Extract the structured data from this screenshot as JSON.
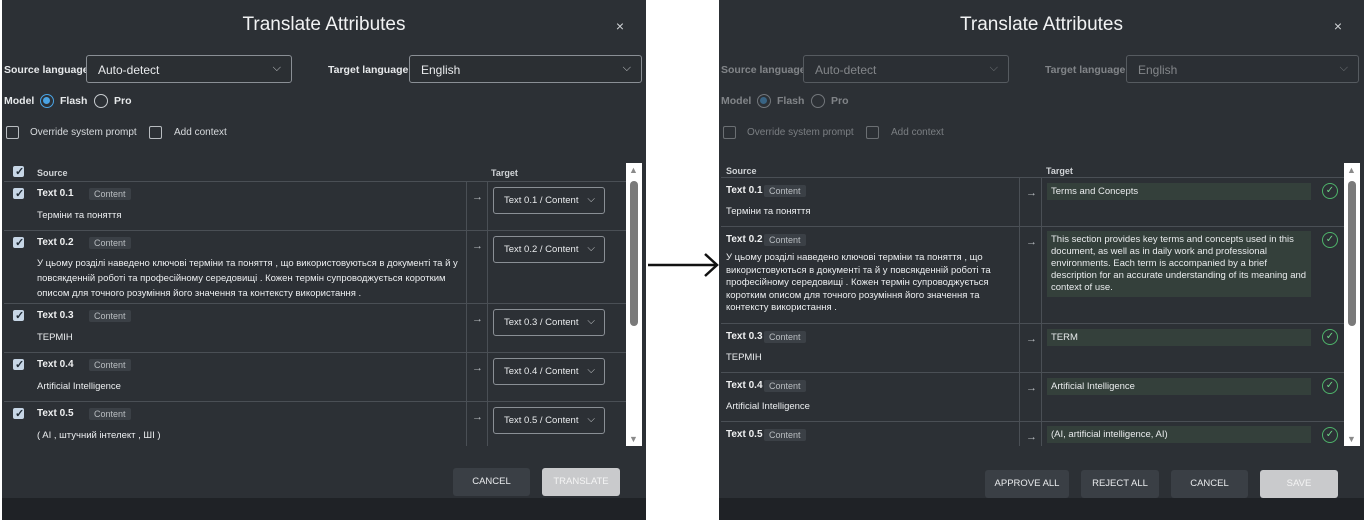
{
  "left": {
    "title": "Translate Attributes",
    "close": "×",
    "source_language_label": "Source language",
    "source_language_value": "Auto-detect",
    "target_language_label": "Target language",
    "target_language_value": "English",
    "model_label": "Model",
    "model_options": [
      "Flash",
      "Pro"
    ],
    "override_label": "Override system prompt",
    "add_context_label": "Add context",
    "col_source": "Source",
    "col_target": "Target",
    "rows": [
      {
        "title": "Text 0.1",
        "badge": "Content",
        "text": "Терміни та поняття",
        "target": "Text 0.1 / Content"
      },
      {
        "title": "Text 0.2",
        "badge": "Content",
        "text": "У цьому розділі наведено ключові терміни та поняття , що використовуються в документі та й у повсякденній роботі та професійному середовищі . Кожен термін супроводжується коротким описом для точного розуміння його значення та контексту використання .",
        "target": "Text 0.2 / Content"
      },
      {
        "title": "Text 0.3",
        "badge": "Content",
        "text": "ТЕРМІН",
        "target": "Text 0.3 / Content"
      },
      {
        "title": "Text 0.4",
        "badge": "Content",
        "text": "Artificial Intelligence",
        "target": "Text 0.4 / Content"
      },
      {
        "title": "Text 0.5",
        "badge": "Content",
        "text": "( AI , штучний інтелект , ШІ )",
        "target": "Text 0.5 / Content"
      }
    ],
    "cancel": "CANCEL",
    "translate": "TRANSLATE"
  },
  "right": {
    "title": "Translate Attributes",
    "close": "×",
    "source_language_label": "Source language",
    "source_language_value": "Auto-detect",
    "target_language_label": "Target language",
    "target_language_value": "English",
    "model_label": "Model",
    "model_options": [
      "Flash",
      "Pro"
    ],
    "override_label": "Override system prompt",
    "add_context_label": "Add context",
    "col_source": "Source",
    "col_target": "Target",
    "rows": [
      {
        "title": "Text 0.1",
        "badge": "Content",
        "text": "Терміни та поняття",
        "translation": "Terms and Concepts"
      },
      {
        "title": "Text 0.2",
        "badge": "Content",
        "text": "У цьому розділі наведено ключові терміни та поняття , що використовуються в документі та й у повсякденній роботі та професійному середовищі . Кожен термін супроводжується коротким описом для точного розуміння його значення та контексту використання .",
        "translation": "This section provides key terms and concepts used in this document, as well as in daily work and professional environments. Each term is accompanied by a brief description for an accurate understanding of its meaning and context of use."
      },
      {
        "title": "Text 0.3",
        "badge": "Content",
        "text": "ТЕРМІН",
        "translation": "TERM"
      },
      {
        "title": "Text 0.4",
        "badge": "Content",
        "text": "Artificial Intelligence",
        "translation": "Artificial Intelligence"
      },
      {
        "title": "Text 0.5",
        "badge": "Content",
        "text": "",
        "translation": "(AI, artificial intelligence, AI)"
      }
    ],
    "approve_all": "APPROVE ALL",
    "reject_all": "REJECT ALL",
    "cancel": "CANCEL",
    "save": "SAVE"
  },
  "glyphs": {
    "chevron": "⌵",
    "arrow_right": "→",
    "check": "✓",
    "scroll_up": "▲",
    "scroll_down": "▼"
  }
}
